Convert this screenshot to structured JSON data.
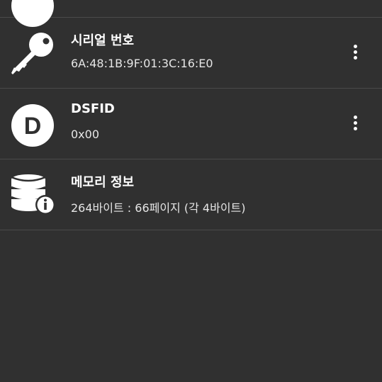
{
  "rows": [
    {
      "icon": "partial-circle-icon",
      "title": "",
      "value": ""
    },
    {
      "icon": "key-icon",
      "title": "시리얼 번호",
      "value": "6A:48:1B:9F:01:3C:16:E0",
      "has_menu": true
    },
    {
      "icon": "letter-d-icon",
      "icon_letter": "D",
      "title": "DSFID",
      "value": "0x00",
      "has_menu": true
    },
    {
      "icon": "database-info-icon",
      "title": "메모리 정보",
      "value": "264바이트 : 66페이지 (각 4바이트)",
      "has_menu": false
    }
  ],
  "colors": {
    "background": "#303030",
    "divider": "#4a4a4a",
    "text": "#ffffff",
    "icon": "#ffffff"
  }
}
